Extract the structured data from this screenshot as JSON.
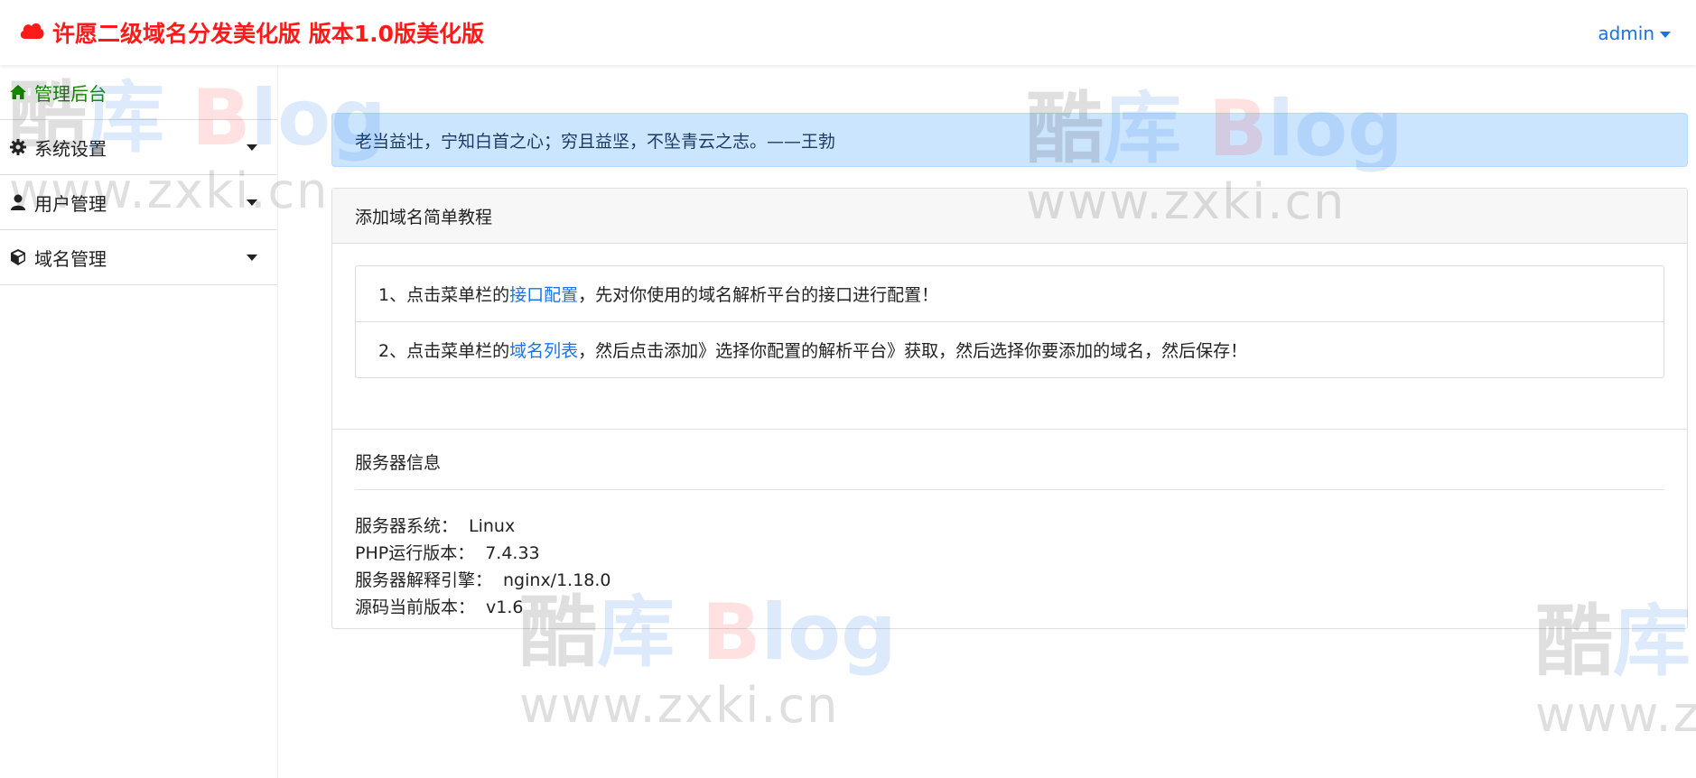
{
  "header": {
    "title": "许愿二级域名分发美化版 版本1.0版美化版",
    "user": "admin"
  },
  "sidebar": {
    "items": [
      {
        "label": "管理后台",
        "icon": "home-icon"
      },
      {
        "label": "系统设置",
        "icon": "gear-icon"
      },
      {
        "label": "用户管理",
        "icon": "user-icon"
      },
      {
        "label": "域名管理",
        "icon": "cube-icon"
      }
    ]
  },
  "alert": {
    "text": "老当益壮，宁知白首之心；穷且益坚，不坠青云之志。——王勃"
  },
  "tutorial": {
    "title": "添加域名简单教程",
    "steps": [
      {
        "prefix": "1、点击菜单栏的",
        "link": "接口配置",
        "suffix": "，先对你使用的域名解析平台的接口进行配置！"
      },
      {
        "prefix": "2、点击菜单栏的",
        "link": "域名列表",
        "suffix": "，然后点击添加》选择你配置的解析平台》获取，然后选择你要添加的域名，然后保存！"
      }
    ]
  },
  "server": {
    "title": "服务器信息",
    "rows": [
      {
        "label": "服务器系统：",
        "value": "Linux"
      },
      {
        "label": "PHP运行版本：",
        "value": "7.4.33"
      },
      {
        "label": "服务器解释引擎：",
        "value": "nginx/1.18.0"
      },
      {
        "label": "源码当前版本：",
        "value": "v1.6"
      }
    ]
  },
  "watermark": {
    "cn_part1": "酷",
    "cn_part2": "库",
    "brand_b": "B",
    "brand_log": "log",
    "url": "www.zxki.cn"
  },
  "colors": {
    "brand_red": "#ff1a1a",
    "link_blue": "#1a73e8",
    "active_green": "#138a00",
    "alert_bg": "#cce5ff"
  }
}
